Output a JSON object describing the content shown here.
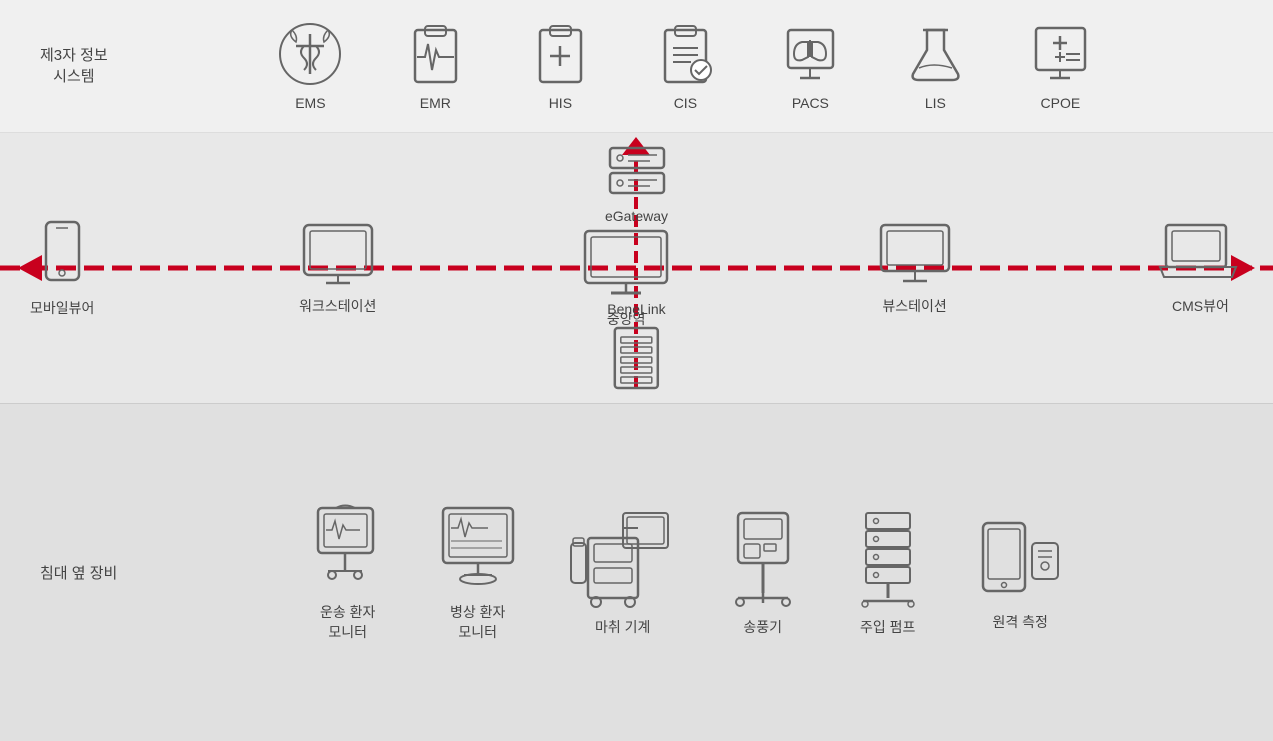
{
  "top": {
    "section_label": "제3자 정보\n시스템",
    "systems": [
      {
        "id": "ems",
        "label": "EMS"
      },
      {
        "id": "emr",
        "label": "EMR"
      },
      {
        "id": "his",
        "label": "HIS"
      },
      {
        "id": "cis",
        "label": "CIS"
      },
      {
        "id": "pacs",
        "label": "PACS"
      },
      {
        "id": "lis",
        "label": "LIS"
      },
      {
        "id": "cpoe",
        "label": "CPOE"
      }
    ]
  },
  "middle": {
    "egateway_label": "eGateway",
    "benelink_label": "BeneLink",
    "devices": [
      {
        "id": "mobile",
        "label": "모바일뷰어"
      },
      {
        "id": "workstation",
        "label": "워크스테이션"
      },
      {
        "id": "central",
        "label": "중앙역"
      },
      {
        "id": "viewstation",
        "label": "뷰스테이션"
      },
      {
        "id": "cms",
        "label": "CMS뷰어"
      }
    ]
  },
  "bottom": {
    "section_label": "침대 옆 장비",
    "devices": [
      {
        "id": "transport",
        "label": "운송 환자\n모니터"
      },
      {
        "id": "bedside",
        "label": "병상 환자\n모니터"
      },
      {
        "id": "anesthesia",
        "label": "마취 기계"
      },
      {
        "id": "ventilator",
        "label": "송풍기"
      },
      {
        "id": "pump",
        "label": "주입 펌프"
      },
      {
        "id": "remote",
        "label": "원격 측정"
      }
    ]
  },
  "colors": {
    "red": "#c8001e",
    "dark_gray": "#555",
    "mid_gray": "#888",
    "light_gray": "#bbb"
  }
}
